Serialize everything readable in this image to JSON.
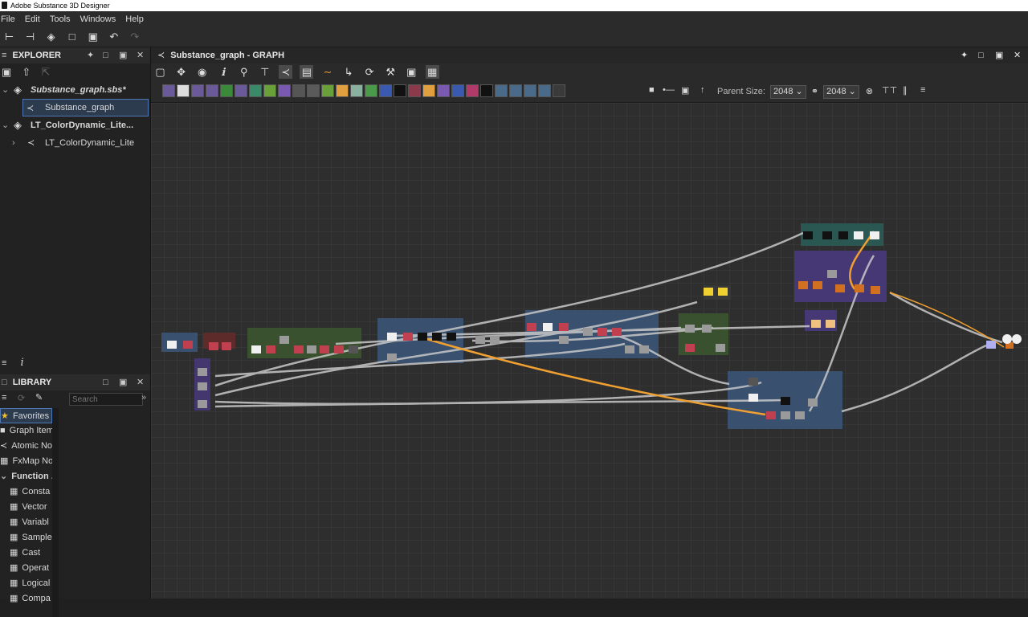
{
  "app": {
    "title": "Adobe Substance 3D Designer"
  },
  "menu": [
    "File",
    "Edit",
    "Tools",
    "Windows",
    "Help"
  ],
  "explorer": {
    "title": "EXPLORER",
    "items": [
      {
        "label": "Substance_graph.sbs*"
      },
      {
        "label": "Substance_graph"
      },
      {
        "label": "LT_ColorDynamic_Lite..."
      },
      {
        "label": "LT_ColorDynamic_Lite"
      }
    ]
  },
  "library": {
    "title": "LIBRARY",
    "search_placeholder": "Search",
    "categories": [
      {
        "label": "Favorites"
      },
      {
        "label": "Graph Item"
      },
      {
        "label": "Atomic No"
      },
      {
        "label": "FxMap No."
      },
      {
        "label": "Function ."
      }
    ],
    "functions": [
      {
        "label": "Consta"
      },
      {
        "label": "Vector"
      },
      {
        "label": "Variabl"
      },
      {
        "label": "Sample"
      },
      {
        "label": "Cast"
      },
      {
        "label": "Operat"
      },
      {
        "label": "Logical"
      },
      {
        "label": "Compa"
      }
    ]
  },
  "graph": {
    "tab_title": "Substance_graph - GRAPH",
    "parent_size_label": "Parent Size:",
    "size_w": "2048",
    "size_h": "2048",
    "info_glyph": "i"
  },
  "colors": {
    "accent": "#4d78b5",
    "link_orange": "#f0a030",
    "frame_blue": "#3c5a80",
    "frame_green": "#3d5a30",
    "frame_purple": "#4a3a80",
    "frame_teal": "#2a5e58",
    "frame_red": "#6a2a2a"
  }
}
